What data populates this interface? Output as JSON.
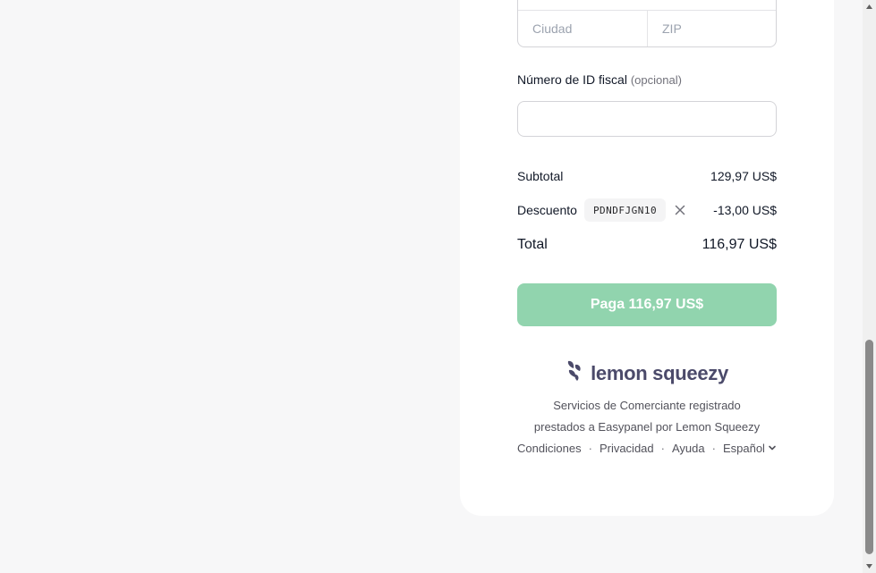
{
  "address": {
    "city_placeholder": "Ciudad",
    "zip_placeholder": "ZIP"
  },
  "tax_id": {
    "label": "Número de ID fiscal",
    "optional": "(opcional)",
    "value": ""
  },
  "summary": {
    "subtotal_label": "Subtotal",
    "subtotal_value": "129,97 US$",
    "discount_label": "Descuento",
    "discount_code": "PDNDFJGN10",
    "discount_value": "-13,00 US$",
    "total_label": "Total",
    "total_value": "116,97 US$"
  },
  "pay_button": {
    "label": "Paga 116,97 US$"
  },
  "footer": {
    "brand": "lemon squeezy",
    "line1": "Servicios de Comerciante registrado",
    "line2": "prestados a Easypanel por Lemon Squeezy",
    "links": {
      "terms": "Condiciones",
      "privacy": "Privacidad",
      "help": "Ayuda",
      "language": "Español",
      "separator": "·"
    }
  },
  "colors": {
    "pay_button": "#91d4ae",
    "brand": "#4b4a6a",
    "page_bg": "#f7f7f8",
    "card_bg": "#ffffff"
  },
  "icons": {
    "remove_discount": "close-icon",
    "brand_logo": "lemon-squeezy-logo-icon",
    "language_dropdown": "chevron-down-icon"
  }
}
